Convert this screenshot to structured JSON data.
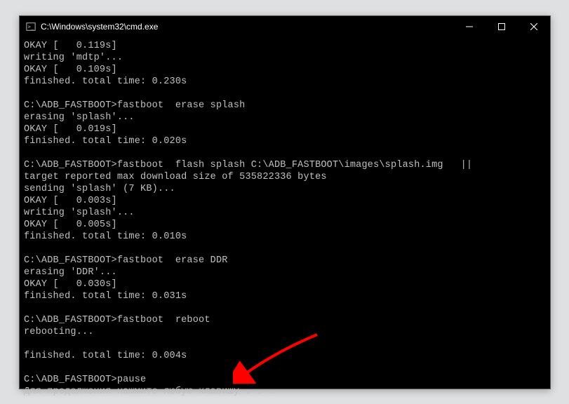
{
  "window": {
    "title": "C:\\Windows\\system32\\cmd.exe"
  },
  "terminal": {
    "lines": [
      "OKAY [   0.119s]",
      "writing 'mdtp'...",
      "OKAY [   0.109s]",
      "finished. total time: 0.230s",
      "",
      "C:\\ADB_FASTBOOT>fastboot  erase splash",
      "erasing 'splash'...",
      "OKAY [   0.019s]",
      "finished. total time: 0.020s",
      "",
      "C:\\ADB_FASTBOOT>fastboot  flash splash C:\\ADB_FASTBOOT\\images\\splash.img   ||",
      "target reported max download size of 535822336 bytes",
      "sending 'splash' (7 KB)...",
      "OKAY [   0.003s]",
      "writing 'splash'...",
      "OKAY [   0.005s]",
      "finished. total time: 0.010s",
      "",
      "C:\\ADB_FASTBOOT>fastboot  erase DDR",
      "erasing 'DDR'...",
      "OKAY [   0.030s]",
      "finished. total time: 0.031s",
      "",
      "C:\\ADB_FASTBOOT>fastboot  reboot",
      "rebooting...",
      "",
      "finished. total time: 0.004s",
      "",
      "C:\\ADB_FASTBOOT>pause",
      "Для продолжения нажмите любую клавишу . . ."
    ]
  },
  "arrow": {
    "color": "#ff0000"
  }
}
